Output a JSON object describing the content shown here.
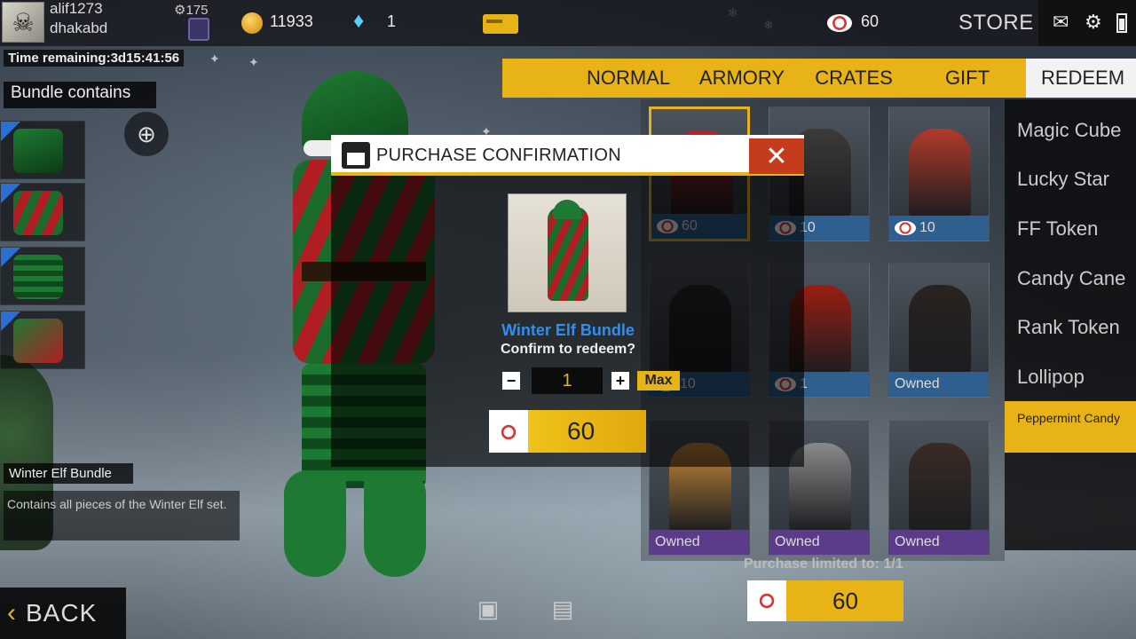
{
  "topbar": {
    "username": "alif1273",
    "server": "dhakabd",
    "level": "175",
    "gold": "11933",
    "diamonds": "1",
    "vouchers": "60",
    "store_label": "STORE"
  },
  "left_panel": {
    "time_remaining": "Time remaining:3d15:41:56",
    "bundle_contains": "Bundle contains",
    "bundle_name": "Winter Elf Bundle",
    "bundle_description": "Contains all pieces of the Winter Elf set.",
    "back_label": "BACK"
  },
  "tabs": [
    {
      "label": "NORMAL"
    },
    {
      "label": "ARMORY"
    },
    {
      "label": "CRATES"
    },
    {
      "label": "GIFT"
    },
    {
      "label": "REDEEM"
    }
  ],
  "categories": [
    {
      "label": "Magic Cube"
    },
    {
      "label": "Lucky Star"
    },
    {
      "label": "FF Token"
    },
    {
      "label": "Candy Cane"
    },
    {
      "label": "Rank Token"
    },
    {
      "label": "Lollipop"
    },
    {
      "label": "Peppermint Candy"
    }
  ],
  "grid": [
    {
      "footer": "60",
      "voucher": true,
      "selected": true,
      "tone": "#b8242a"
    },
    {
      "footer": "10",
      "voucher": true,
      "tone": "#3d3a38"
    },
    {
      "footer": "10",
      "voucher": true,
      "tone": "#b23a2a"
    },
    {
      "footer": "10",
      "voucher": true,
      "tone": "#2c2626"
    },
    {
      "footer": "1",
      "voucher": true,
      "tone": "#9a1e12"
    },
    {
      "footer": "Owned",
      "voucher": false,
      "tone": "#2a2220"
    },
    {
      "footer": "Owned",
      "voucher": false,
      "purple": true,
      "tone": "#c88a3a"
    },
    {
      "footer": "Owned",
      "voucher": false,
      "purple": true,
      "tone": "#8a8a8a"
    },
    {
      "footer": "Owned",
      "voucher": false,
      "purple": true,
      "tone": "#3a2a26"
    }
  ],
  "purchase_limit": "Purchase limited to: 1/1",
  "price": "60",
  "modal": {
    "title": "PURCHASE CONFIRMATION",
    "item_name": "Winter Elf Bundle",
    "confirm_text": "Confirm to redeem?",
    "quantity": "1",
    "max_label": "Max",
    "price": "60"
  },
  "colors": {
    "accent": "#e7b317",
    "close": "#c43c1c",
    "item_name": "#2f8ff0"
  }
}
